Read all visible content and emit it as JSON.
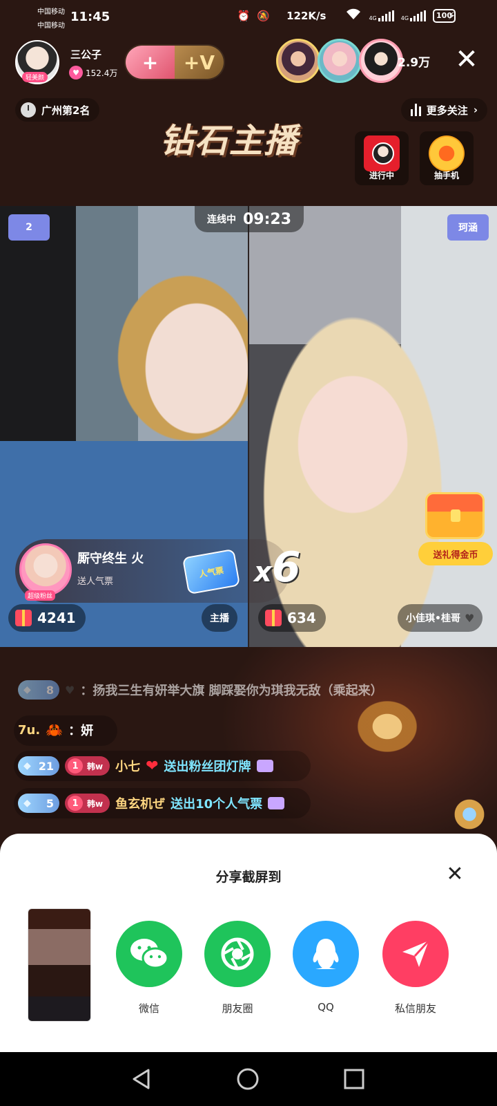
{
  "status_bar": {
    "carrier_1": "中国移动",
    "carrier_2": "中国移动",
    "time": "11:45",
    "net_speed": "122K/s",
    "sim1_label": "4G",
    "sim2_label": "4G",
    "battery": "100"
  },
  "header": {
    "host_name": "三公子",
    "host_tag": "轻美颜",
    "host_likes": "152.4万",
    "viewer_count": "2.9万",
    "rank_text": "广州第2名",
    "more_follow": "更多关注",
    "banner_title": "钻石主播",
    "activities": [
      {
        "label": "进行中"
      },
      {
        "label": "抽手机"
      }
    ]
  },
  "video": {
    "link_label": "连线中",
    "link_time": "09:23",
    "left_team": "2",
    "right_team": "珂涵",
    "left_score": "4241",
    "right_score": "634",
    "left_role": "主播",
    "right_role": "小佳琪•桂哥",
    "treasure_label": "送礼得金币",
    "gift_popup": {
      "sender": "厮守终生 火",
      "avatar_tag": "超级粉丝",
      "action": "送人气票",
      "gift_name": "人气票",
      "count": "6"
    }
  },
  "chat": [
    {
      "level": "8",
      "user": "",
      "text": "扬我三生有妍举大旗 脚踩娶你为琪我无敌（乘起来）"
    },
    {
      "level": "",
      "user": "7u.",
      "text": "妍"
    },
    {
      "level": "21",
      "fan_level": "1",
      "fan_name": "韩w",
      "user": "小七",
      "action": "送出粉丝团灯牌"
    },
    {
      "level": "5",
      "fan_level": "1",
      "fan_name": "韩w",
      "user": "鱼玄机ぜ",
      "action": "送出10个人气票"
    }
  ],
  "share_sheet": {
    "title": "分享截屏到",
    "options": [
      {
        "label": "微信"
      },
      {
        "label": "朋友圈"
      },
      {
        "label": "QQ"
      },
      {
        "label": "私信朋友"
      }
    ]
  },
  "colors": {
    "wechat_green": "#1fc45b",
    "qq_blue": "#2aa8ff",
    "dm_red": "#ff3e63",
    "team_badge": "#7d88e6"
  }
}
